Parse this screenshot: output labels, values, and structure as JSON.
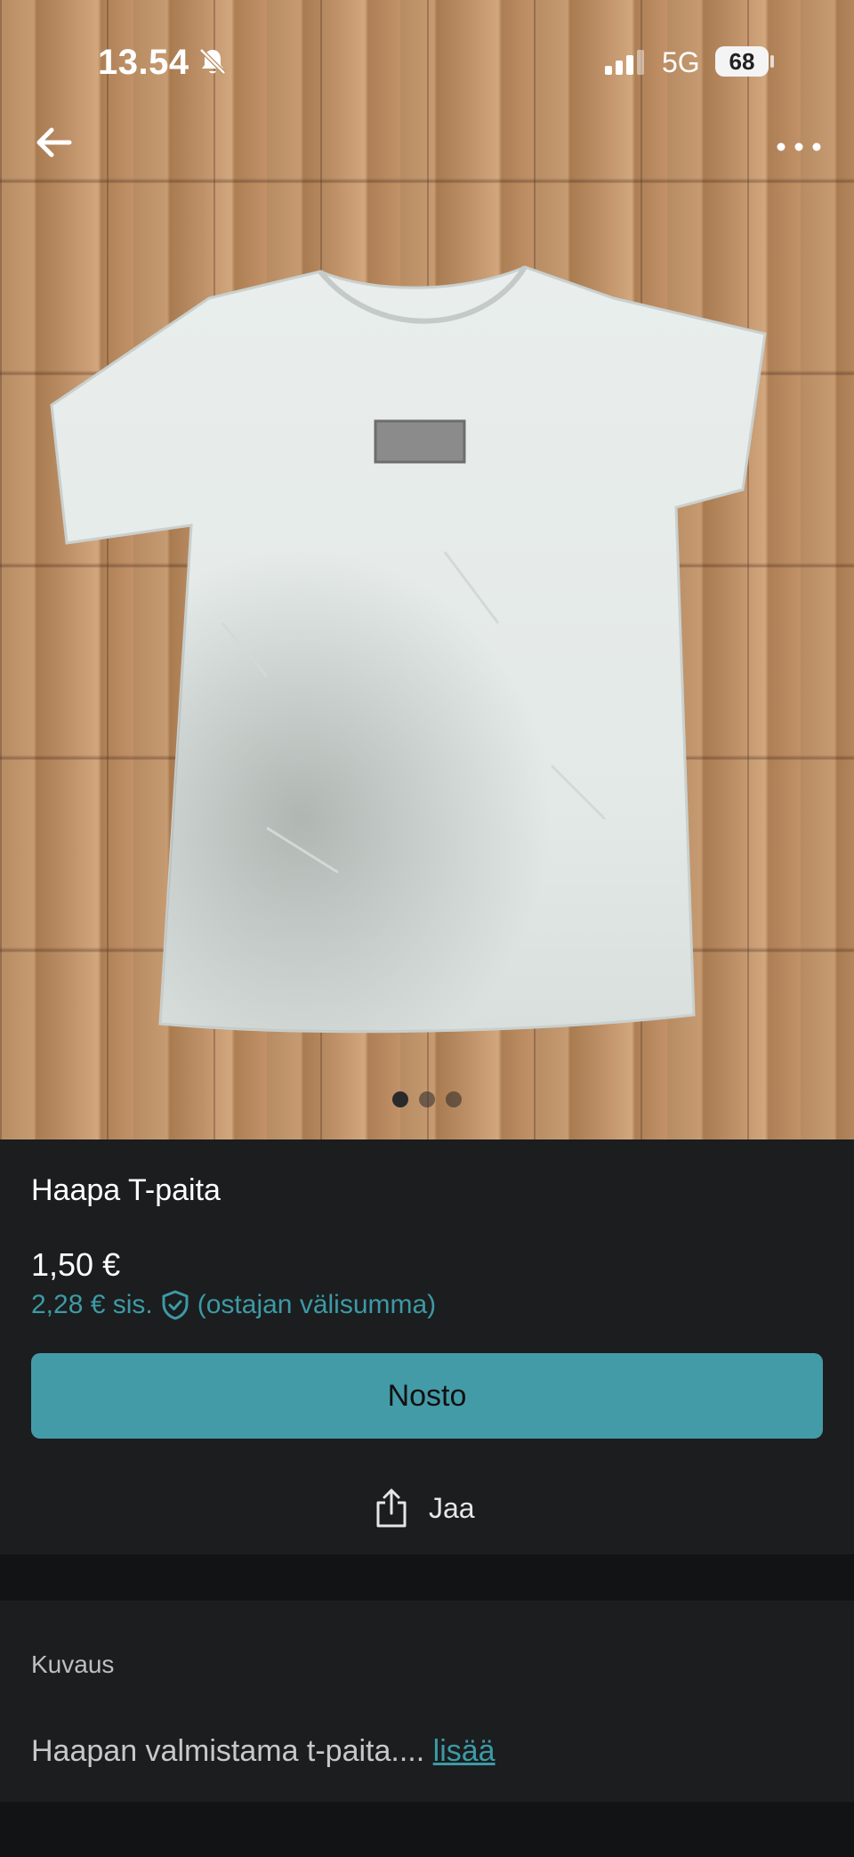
{
  "status_bar": {
    "time": "13.54",
    "network": "5G",
    "battery": "68"
  },
  "icons": {
    "back": "arrow-left-icon",
    "more": "more-dots-icon",
    "notifications_off": "bell-off-icon",
    "signal": "signal-bars-icon",
    "shield": "shield-check-icon",
    "share": "share-icon"
  },
  "gallery": {
    "image_count": 3,
    "active_index": 0
  },
  "product": {
    "title": "Haapa T-paita",
    "price": "1,50 €",
    "buyer_total": "2,28 € sis.",
    "buyer_total_note": "(ostajan välisumma)"
  },
  "actions": {
    "primary_label": "Nosto",
    "share_label": "Jaa"
  },
  "description": {
    "heading": "Kuvaus",
    "text": "Haapan valmistama t-paita....",
    "more_label": "lisää"
  },
  "colors": {
    "accent": "#449ba8",
    "accent_text": "#3d9aa5",
    "background": "#1b1d1f",
    "divider": "#111315"
  }
}
